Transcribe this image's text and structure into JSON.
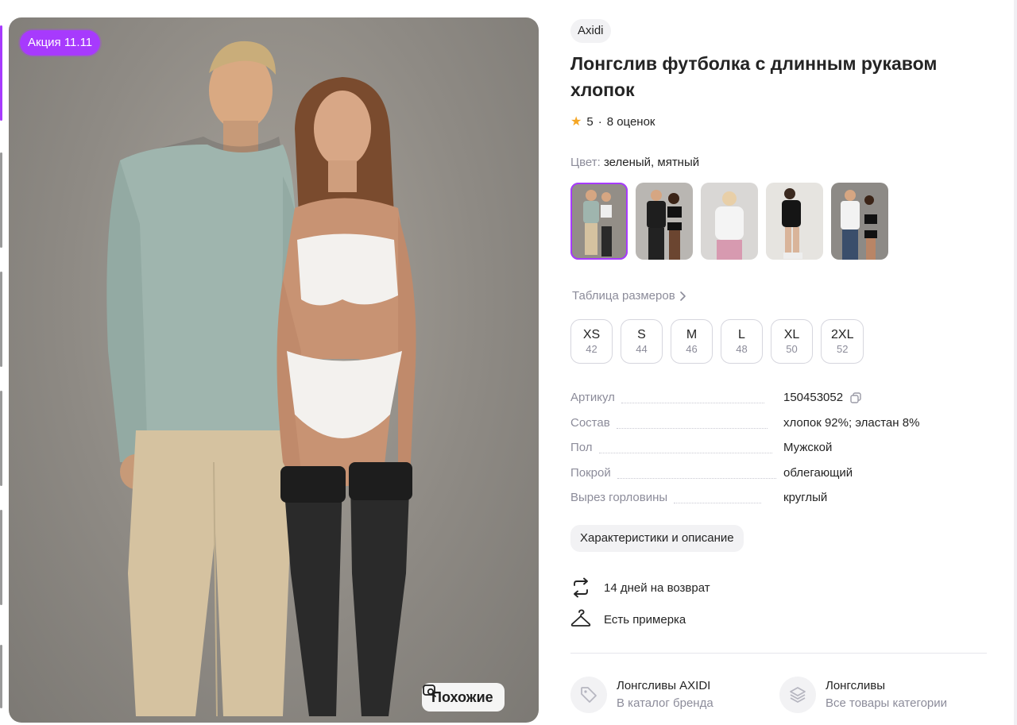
{
  "gallery": {
    "promo_badge": "Акция 11.11",
    "similar_label": "Похожие",
    "similar_icon": "search-image-icon"
  },
  "product": {
    "brand": "Axidi",
    "title": "Лонгслив футболка с длинным рукавом хлопок",
    "rating": "5",
    "reviews": "8 оценок",
    "rating_separator": "·",
    "color_label": "Цвет:",
    "color_value": "зеленый, мятный"
  },
  "color_swatches": [
    {
      "name": "mint-green",
      "active": true
    },
    {
      "name": "black",
      "active": false
    },
    {
      "name": "white-pink",
      "active": false
    },
    {
      "name": "black-white",
      "active": false
    },
    {
      "name": "white",
      "active": false
    }
  ],
  "size_table_label": "Таблица размеров",
  "sizes": [
    {
      "size": "XS",
      "ru": "42"
    },
    {
      "size": "S",
      "ru": "44"
    },
    {
      "size": "M",
      "ru": "46"
    },
    {
      "size": "L",
      "ru": "48"
    },
    {
      "size": "XL",
      "ru": "50"
    },
    {
      "size": "2XL",
      "ru": "52"
    }
  ],
  "specs": [
    {
      "key": "Артикул",
      "value": "150453052"
    },
    {
      "key": "Состав",
      "value": "хлопок 92%; эластан 8%"
    },
    {
      "key": "Пол",
      "value": "Мужской"
    },
    {
      "key": "Покрой",
      "value": "облегающий"
    },
    {
      "key": "Вырез горловины",
      "value": "круглый"
    }
  ],
  "description_button": "Характеристики и описание",
  "features": [
    {
      "icon": "return-arrows-icon",
      "text": "14 дней на возврат"
    },
    {
      "icon": "hanger-icon",
      "text": "Есть примерка"
    }
  ],
  "links": [
    {
      "icon": "tag-icon",
      "title": "Лонгсливы AXIDI",
      "subtitle": "В каталог бренда"
    },
    {
      "icon": "layers-icon",
      "title": "Лонгсливы",
      "subtitle": "Все товары категории"
    }
  ],
  "colors": {
    "accent": "#a73afd",
    "text": "#242424",
    "muted": "#8c8c9a",
    "chip_bg": "#f2f2f4",
    "star": "#f5a623"
  }
}
